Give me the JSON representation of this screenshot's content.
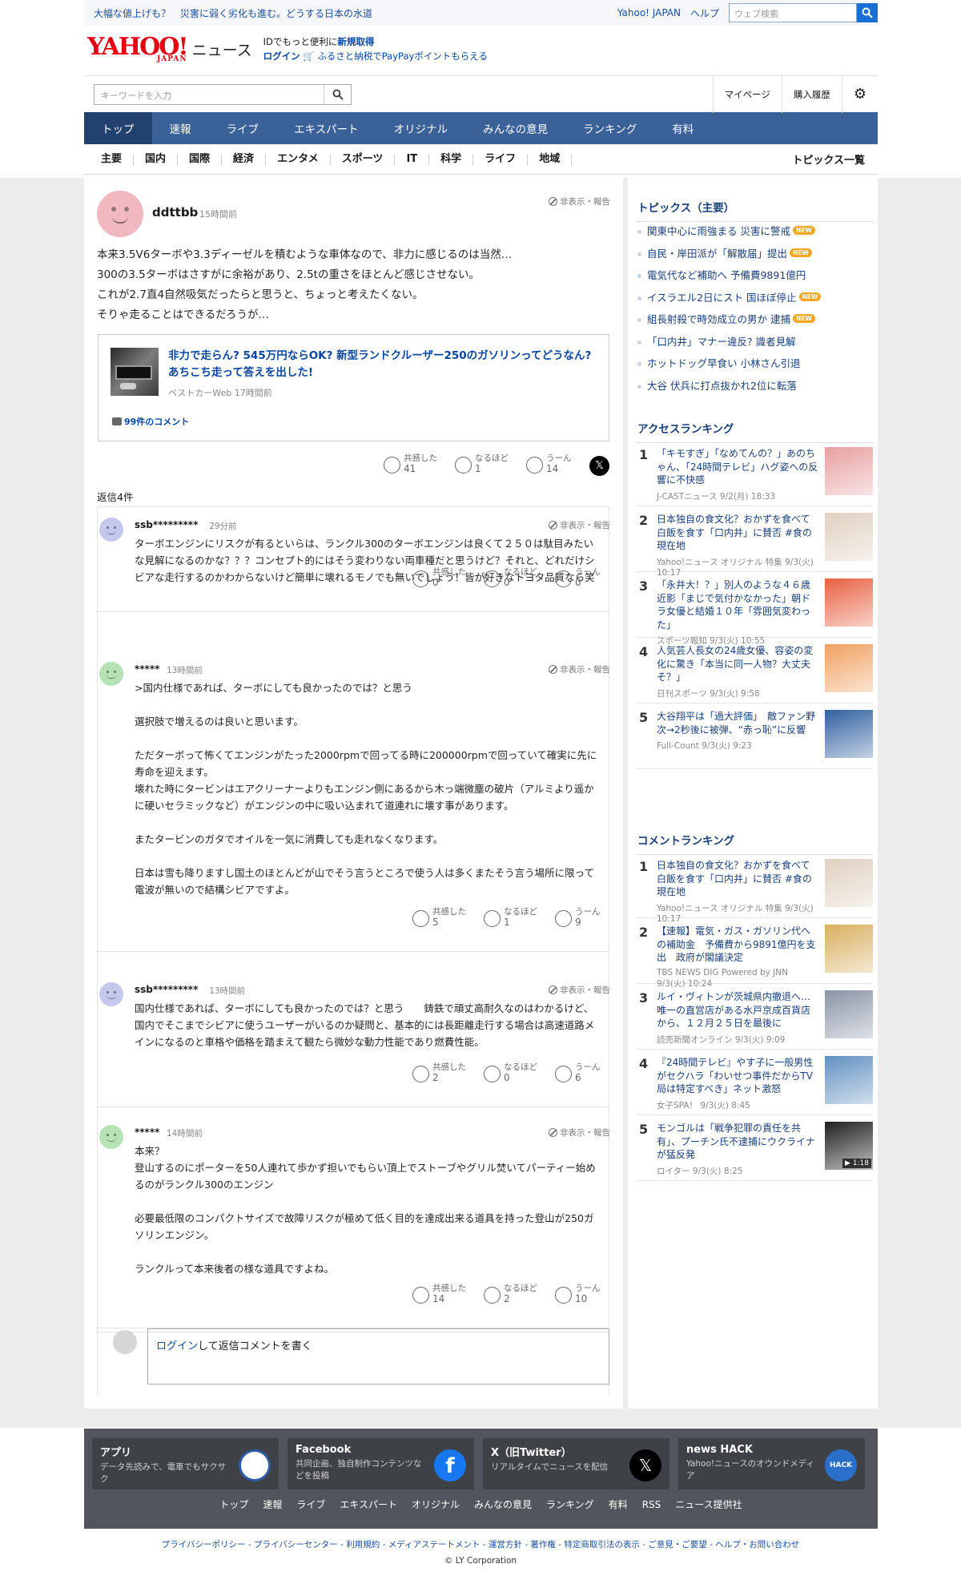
{
  "topbar": {
    "promo1": "大幅な値上げも？　災害に弱く劣化も進む。どうする日本の水道",
    "yahoo_japan": "Yahoo! JAPAN",
    "help": "ヘルプ",
    "web_search_placeholder": "ウェブ検索"
  },
  "logo": {
    "yahoo": "YAHOO!",
    "japan": "JAPAN",
    "news": "ニュース"
  },
  "promo": {
    "line1_prefix": "IDでもっと便利に",
    "line1_link": "新規取得",
    "login": "ログイン",
    "line2": "ふるさと納税でPayPayポイントもらえる"
  },
  "search": {
    "placeholder": "キーワードを入力",
    "mypage": "マイページ",
    "history": "購入履歴"
  },
  "main_nav": [
    "トップ",
    "速報",
    "ライブ",
    "エキスパート",
    "オリジナル",
    "みんなの意見",
    "ランキング",
    "有料"
  ],
  "sub_nav": [
    "主要",
    "国内",
    "国際",
    "経済",
    "エンタメ",
    "スポーツ",
    "IT",
    "科学",
    "ライフ",
    "地域"
  ],
  "topics_link": "トピックス一覧",
  "post": {
    "user": "ddttbb",
    "time": "15時間前",
    "report": "非表示・報告",
    "text": "本来3.5V6ターボや3.3ディーゼルを積むような車体なので、非力に感じるのは当然…\n300の3.5ターボはさすがに余裕があり、2.5tの重さをほとんど感じさせない。\nこれが2.7直4自然吸気だったらと思うと、ちょっと考えたくない。\nそりゃ走ることはできるだろうが…",
    "article": {
      "title": "非力で走らん? 545万円ならOK? 新型ランドクルーザー250のガソリンってどうなん? あちこち走って答えを出した!",
      "source": "ベストカーWeb 17時間前",
      "comments": "99件のコメント"
    },
    "reactions": [
      {
        "label": "共感した",
        "count": "41"
      },
      {
        "label": "なるほど",
        "count": "1"
      },
      {
        "label": "うーん",
        "count": "14"
      }
    ]
  },
  "reply_count": "返信4件",
  "replies": [
    {
      "user": "ssb*********",
      "time": "29分前",
      "report": "非表示・報告",
      "avatar_color": "#c5c8ec",
      "text": "ターボエンジンにリスクが有るといらは、ランクル300のターボエンジンは良くて２５０は駄目みたいな見解になるのかな？？？コンセプト的にはそう変わりない両車種だと思うけど？それと、どれだけシビアな走行するのかわからないけど簡単に壊れるモノでも無いでしょう！皆が好きなトヨタ品質なら笑",
      "reactions": [
        "0",
        "0",
        "0"
      ]
    },
    {
      "user": "*****",
      "time": "13時間前",
      "report": "非表示・報告",
      "avatar_color": "#b6e2b6",
      "text": ">国内仕様であれば、ターボにしても良かったのでは？と思う\n\n選択肢で増えるのは良いと思います。\n\nただターボって怖くてエンジンがたった2000rpmで回ってる時に200000rpmで回っていて確実に先に寿命を迎えます。\n壊れた時にタービンはエアクリーナーよりもエンジン側にあるから木っ端微塵の破片（アルミより遥かに硬いセラミックなど）がエンジンの中に吸い込まれて道連れに壊す事があります。\n\nまたタービンのガタでオイルを一気に消費しても走れなくなります。\n\n日本は雪も降りますし国土のほとんどが山でそう言うところで使う人は多くまたそう言う場所に限って電波が無いので結構シビアですよ。",
      "reactions": [
        "5",
        "1",
        "9"
      ]
    },
    {
      "user": "ssb*********",
      "time": "13時間前",
      "report": "非表示・報告",
      "avatar_color": "#c5c8ec",
      "text": "国内仕様であれば、ターボにしても良かったのでは？と思う　　鋳鉄で頑丈高耐久なのはわかるけど、国内でそこまでシビアに使うユーザーがいるのか疑問と、基本的には長距離走行する場合は高速道路メインになるのと車格や価格を踏まえて観たら微妙な動力性能であり燃費性能。",
      "reactions": [
        "2",
        "0",
        "6"
      ]
    },
    {
      "user": "*****",
      "time": "14時間前",
      "report": "非表示・報告",
      "avatar_color": "#b6e2b6",
      "text": "本来？\n登山するのにポーターを50人連れて歩かず担いでもらい頂上でストーブやグリル焚いてパーティー始めるのがランクル300のエンジン\n\n必要最低限のコンパクトサイズで故障リスクが極めて低く目的を達成出来る道具を持った登山が250ガソリンエンジン。\n\nランクルって本来後者の様な道具ですよね。",
      "reactions": [
        "14",
        "2",
        "10"
      ]
    }
  ],
  "reaction_labels": [
    "共感した",
    "なるほど",
    "うーん"
  ],
  "reply_box": {
    "login": "ログイン",
    "text": "して返信コメントを書く"
  },
  "side": {
    "topics_title": "トピックス（主要）",
    "topics": [
      {
        "t": "関東中心に雨強まる 災害に警戒",
        "new": true
      },
      {
        "t": "自民・岸田派が「解散届」提出",
        "new": true
      },
      {
        "t": "電気代など補助へ 予備費9891億円",
        "new": false
      },
      {
        "t": "イスラエル2日にスト 国ほぼ停止",
        "new": true
      },
      {
        "t": "組長射殺で時効成立の男か 逮捕",
        "new": true
      },
      {
        "t": "「口内井」マナー違反? 識者見解",
        "new": false
      },
      {
        "t": "ホットドッグ早食い 小林さん引退",
        "new": false
      },
      {
        "t": "大谷 伏兵に打点抜かれ2位に転落",
        "new": false
      }
    ],
    "new_label": "NEW",
    "access_title": "アクセスランキング",
    "access": [
      {
        "n": "1",
        "t": "「キモすぎ」「なめてんの？」あのちゃん、「24時間テレビ」ハグ姿への反響に不快感",
        "s": "J-CASTニュース 9/2(月) 18:33"
      },
      {
        "n": "2",
        "t": "日本独自の食文化？おかずを食べて白飯を食す「口内井」に賛否 #食の現在地",
        "s": "Yahoo!ニュース オリジナル 特集 9/3(火) 10:17"
      },
      {
        "n": "3",
        "t": "「永井大！？」別人のような４６歳近影「まじで気付かなかった」朝ドラ女優と結婚１０年「雰囲気変わった」",
        "s": "スポーツ報知 9/3(火) 10:55"
      },
      {
        "n": "4",
        "t": "人気芸人長女の24歳女優、容姿の変化に驚き「本当に同一人物？大丈夫そ？」",
        "s": "日刊スポーツ 9/3(火) 9:58"
      },
      {
        "n": "5",
        "t": "大谷翔平は「過大評価」　敵ファン野次→2秒後に被弾、“赤っ恥”に反響",
        "s": "Full-Count 9/3(火) 9:23"
      }
    ],
    "comment_title": "コメントランキング",
    "comments": [
      {
        "n": "1",
        "t": "日本独自の食文化？おかずを食べて白飯を食す「口内井」に賛否 #食の現在地",
        "s": "Yahoo!ニュース オリジナル 特集 9/3(火) 10:17"
      },
      {
        "n": "2",
        "t": "【速報】電気・ガス・ガソリン代への補助金　予備費から9891億円を支出　政府が閣議決定",
        "s": "TBS NEWS DIG Powered by JNN 9/3(火) 10:24"
      },
      {
        "n": "3",
        "t": "ルイ・ヴィトンが茨城県内撤退へ…唯一の直営店がある水戸京成百貨店から、１２月２５日を最後に",
        "s": "読売新聞オンライン 9/3(火) 9:09"
      },
      {
        "n": "4",
        "t": "『24時間テレビ』やす子に一般男性がセクハラ「わいせつ事件だからTV局は特定すべき」ネット激怒",
        "s": "女子SPA！ 9/3(火) 8:45"
      },
      {
        "n": "5",
        "t": "モンゴルは「戦争犯罪の責任を共有」、プーチン氏不逮捕にウクライナが猛反発",
        "s": "ロイター 9/3(火) 8:25",
        "badge": "1:18"
      }
    ]
  },
  "footer": {
    "boxes": [
      {
        "h": "アプリ",
        "d": "データ先読みで、電車でもサクサク"
      },
      {
        "h": "Facebook",
        "d": "共同企画、独自制作コンテンツなどを投稿"
      },
      {
        "h": "X（旧Twitter）",
        "d": "リアルタイムでニュースを配信"
      },
      {
        "h": "news HACK",
        "d": "Yahoo!ニュースのオウンドメディア"
      }
    ],
    "nav": [
      "トップ",
      "速報",
      "ライブ",
      "エキスパート",
      "オリジナル",
      "みんなの意見",
      "ランキング",
      "有料",
      "RSS",
      "ニュース提供社"
    ],
    "legal": "プライバシーポリシー - プライバシーセンター - 利用規約 - メディアステートメント - 運営方針 - 著作権 - 特定商取引法の表示 - ご意見・ご要望 - ヘルプ・お問い合わせ",
    "copyright": "© LY Corporation"
  }
}
